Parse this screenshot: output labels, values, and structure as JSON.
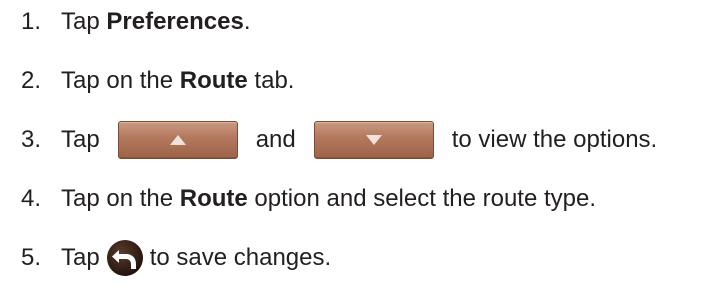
{
  "steps": [
    {
      "number": "1.",
      "pre": "Tap ",
      "bold": "Preferences",
      "post": "."
    },
    {
      "number": "2.",
      "pre": "Tap on the ",
      "bold": "Route",
      "post": " tab."
    },
    {
      "number": "3.",
      "pre": "Tap",
      "mid": "and",
      "post": "to view the options.",
      "icons": [
        "up-arrow-button-icon",
        "down-arrow-button-icon"
      ]
    },
    {
      "number": "4.",
      "pre": "Tap on the ",
      "bold": "Route",
      "post": " option and select the route type."
    },
    {
      "number": "5.",
      "pre": "Tap",
      "post": "to save changes.",
      "icons": [
        "back-arrow-icon"
      ]
    }
  ],
  "colors": {
    "text": "#231f20",
    "button": "#b2775d",
    "back_icon": "#2d1b14"
  }
}
